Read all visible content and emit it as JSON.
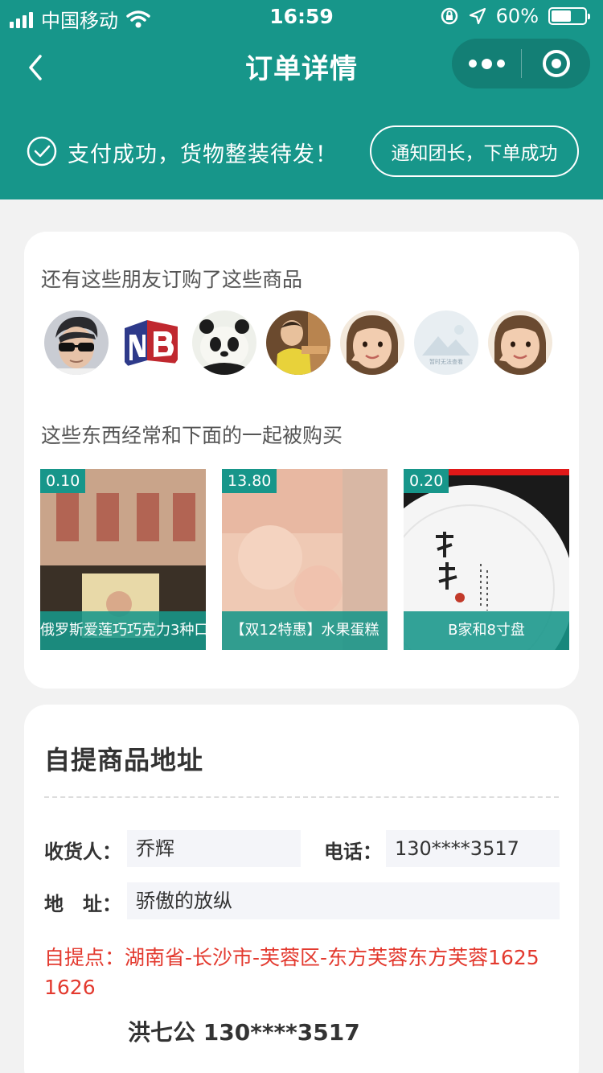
{
  "status_bar": {
    "carrier": "中国移动",
    "time": "16:59",
    "battery": "60%",
    "battery_level": 0.6
  },
  "navbar": {
    "title": "订单详情"
  },
  "banner": {
    "message": "支付成功，货物整装待发！",
    "notify_button": "通知团长，下单成功"
  },
  "friends": {
    "heading": "还有这些朋友订购了这些商品",
    "avatars": [
      {
        "name": "avatar-sunglasses-man"
      },
      {
        "name": "avatar-nb-logo"
      },
      {
        "name": "avatar-panda"
      },
      {
        "name": "avatar-toddler"
      },
      {
        "name": "avatar-girl"
      },
      {
        "name": "avatar-placeholder",
        "text": "暂时无法查看"
      },
      {
        "name": "avatar-girl"
      }
    ]
  },
  "related": {
    "heading": "这些东西经常和下面的一起被购买",
    "products": [
      {
        "price": "0.10",
        "name": "俄罗斯爱莲巧巧克力3种口"
      },
      {
        "price": "13.80",
        "name": "【双12特惠】水果蛋糕"
      },
      {
        "price": "0.20",
        "name": "B家和8寸盘"
      }
    ]
  },
  "address": {
    "title": "自提商品地址",
    "receiver_label": "收货人：",
    "receiver": "乔辉",
    "phone_label": "电话：",
    "phone": "130****3517",
    "address_label": "地　址：",
    "address": "骄傲的放纵",
    "pickup": "自提点：湖南省-长沙市-芙蓉区-东方芙蓉东方芙蓉1625 1626",
    "contact": "洪七公 130****3517"
  },
  "colors": {
    "brand": "#17968a",
    "pickup_text": "#e33a2f"
  }
}
